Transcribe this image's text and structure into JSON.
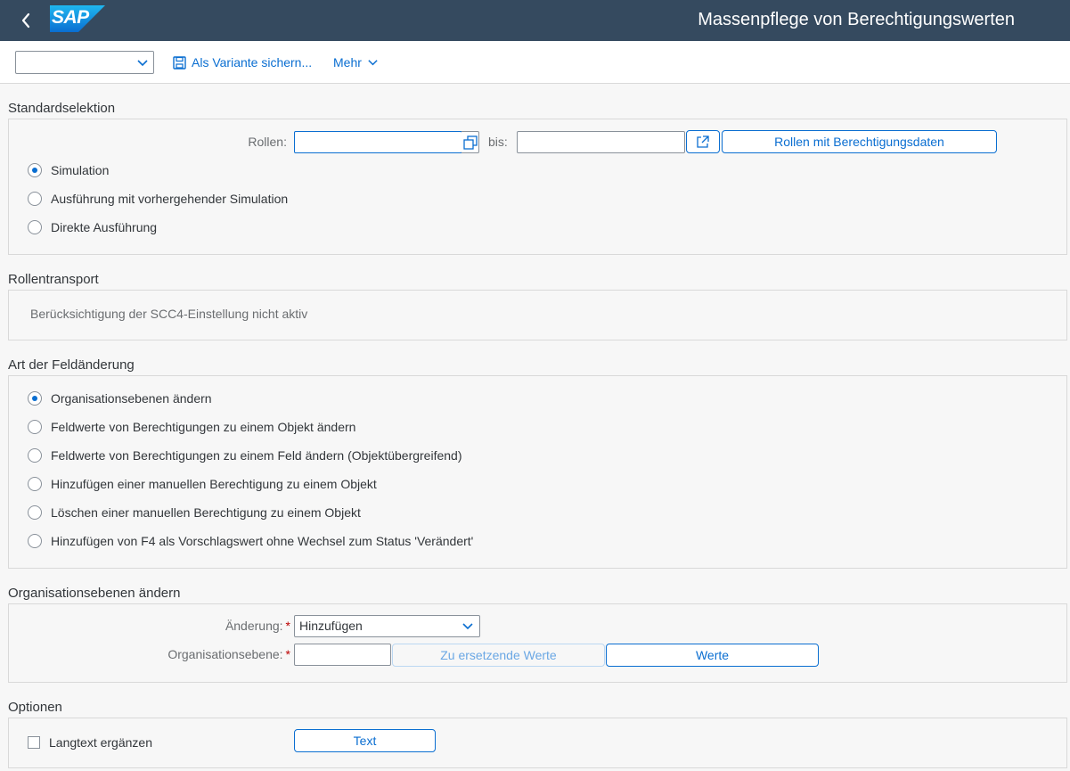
{
  "shell": {
    "logo": "SAP",
    "title": "Massenpflege von Berechtigungswerten"
  },
  "toolbar": {
    "variant_value": "",
    "save_variant_label": "Als Variante sichern...",
    "more_label": "Mehr"
  },
  "standard_selection": {
    "title": "Standardselektion",
    "roles_label": "Rollen:",
    "roles_from": "",
    "to_label": "bis:",
    "roles_to": "",
    "roles_auth_button": "Rollen mit Berechtigungsdaten",
    "modes": [
      {
        "label": "Simulation",
        "selected": true
      },
      {
        "label": "Ausführung mit vorhergehender Simulation",
        "selected": false
      },
      {
        "label": "Direkte Ausführung",
        "selected": false
      }
    ]
  },
  "role_transport": {
    "title": "Rollentransport",
    "info": "Berücksichtigung der SCC4-Einstellung nicht aktiv"
  },
  "field_change_type": {
    "title": "Art der Feldänderung",
    "options": [
      {
        "label": "Organisationsebenen ändern",
        "selected": true
      },
      {
        "label": "Feldwerte von Berechtigungen zu einem Objekt ändern",
        "selected": false
      },
      {
        "label": "Feldwerte von Berechtigungen zu einem Feld ändern (Objektübergreifend)",
        "selected": false
      },
      {
        "label": "Hinzufügen einer manuellen Berechtigung zu einem Objekt",
        "selected": false
      },
      {
        "label": "Löschen einer manuellen Berechtigung zu einem Objekt",
        "selected": false
      },
      {
        "label": "Hinzufügen von F4 als Vorschlagswert ohne Wechsel zum Status 'Verändert'",
        "selected": false
      }
    ]
  },
  "org_levels": {
    "title": "Organisationsebenen ändern",
    "change_label": "Änderung:",
    "change_value": "Hinzufügen",
    "org_level_label": "Organisationsebene:",
    "org_level_value": "",
    "replace_values_button": "Zu ersetzende Werte",
    "values_button": "Werte"
  },
  "options": {
    "title": "Optionen",
    "longtext_label": "Langtext ergänzen",
    "longtext_checked": false,
    "text_button": "Text"
  },
  "colors": {
    "shell_bg": "#354a5f",
    "accent": "#0a6ed1",
    "required": "#bb0000"
  }
}
